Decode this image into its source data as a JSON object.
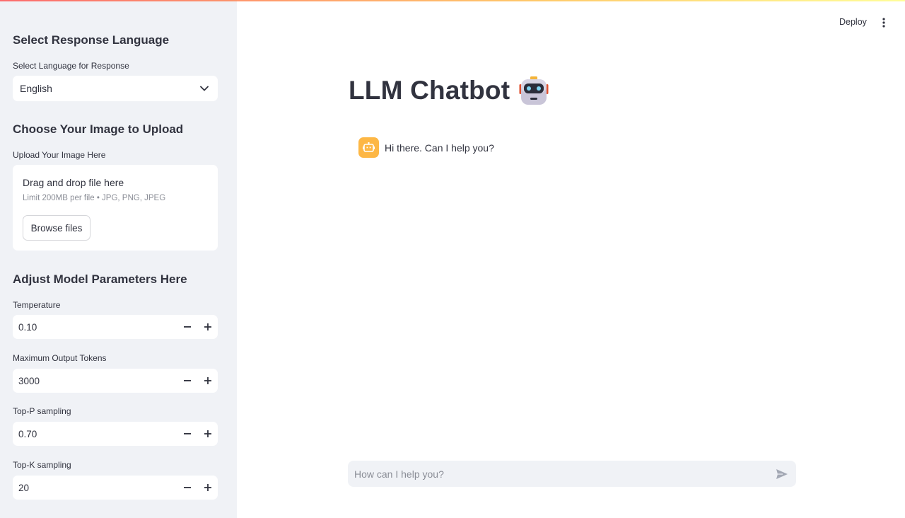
{
  "header": {
    "deploy_label": "Deploy",
    "menu_icon": "vertical-dots-icon"
  },
  "sidebar": {
    "language_section": {
      "heading": "Select Response Language",
      "label": "Select Language for Response",
      "selected": "English"
    },
    "upload_section": {
      "heading": "Choose Your Image to Upload",
      "label": "Upload Your Image Here",
      "dropzone_title": "Drag and drop file here",
      "limit_text": "Limit 200MB per file • JPG, PNG, JPEG",
      "browse_label": "Browse files"
    },
    "params_section": {
      "heading": "Adjust Model Parameters Here",
      "params": [
        {
          "label": "Temperature",
          "value": "0.10"
        },
        {
          "label": "Maximum Output Tokens",
          "value": "3000"
        },
        {
          "label": "Top-P sampling",
          "value": "0.70"
        },
        {
          "label": "Top-K sampling",
          "value": "20"
        }
      ]
    }
  },
  "main": {
    "title": "LLM Chatbot",
    "title_icon": "robot-icon",
    "messages": [
      {
        "role": "assistant",
        "text": "Hi there. Can I help you?"
      }
    ],
    "chat_input": {
      "placeholder": "How can I help you?",
      "send_icon": "send-icon"
    }
  },
  "colors": {
    "sidebar_bg": "#f0f2f6",
    "text": "#31333f",
    "assistant_avatar": "#fdb745",
    "accent": "#ff4b4b"
  }
}
